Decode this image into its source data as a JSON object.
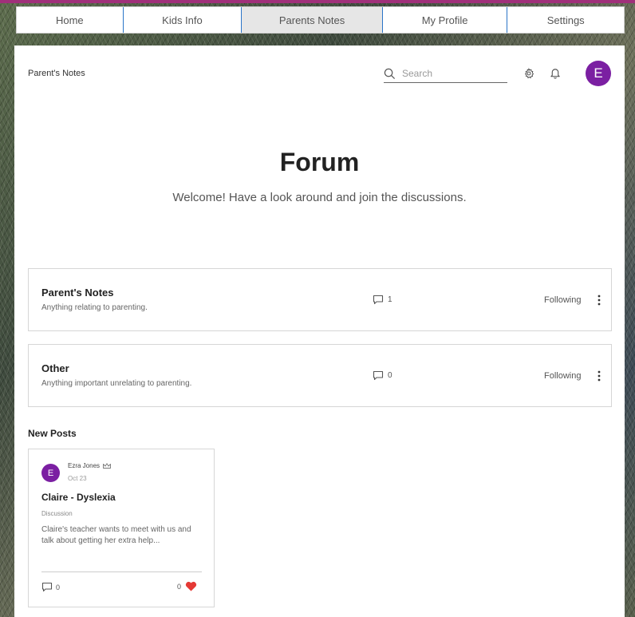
{
  "nav": {
    "tabs": [
      {
        "label": "Home"
      },
      {
        "label": "Kids Info"
      },
      {
        "label": "Parents Notes"
      },
      {
        "label": "My Profile"
      },
      {
        "label": "Settings"
      }
    ],
    "active_tab": "Parents Notes"
  },
  "header": {
    "title": "Parent's Notes",
    "search_placeholder": "Search",
    "icons": [
      "search-icon",
      "gear-icon",
      "bell-icon"
    ],
    "avatar_initial": "E"
  },
  "hero": {
    "title": "Forum",
    "subtitle": "Welcome! Have a look around and join the discussions."
  },
  "categories": [
    {
      "name": "Parent's Notes",
      "description": "Anything relating to parenting.",
      "comment_count": "1",
      "follow_label": "Following"
    },
    {
      "name": "Other",
      "description": "Anything important unrelating to parenting.",
      "comment_count": "0",
      "follow_label": "Following"
    }
  ],
  "new_posts": {
    "title": "New Posts",
    "posts": [
      {
        "author_initial": "E",
        "author": "Ezra Jones",
        "date": "Oct 23",
        "title": "Claire - Dyslexia",
        "category": "Discussion",
        "excerpt": "Claire's teacher wants to meet with us and talk about getting her extra help...",
        "comment_count": "0",
        "like_count": "0"
      }
    ]
  },
  "colors": {
    "accent_purple": "#7b1fa2",
    "tab_divider": "#2a75c8",
    "active_tab_bg": "#e6e6e6",
    "heart": "#e53935",
    "top_line": "#a0307a"
  }
}
